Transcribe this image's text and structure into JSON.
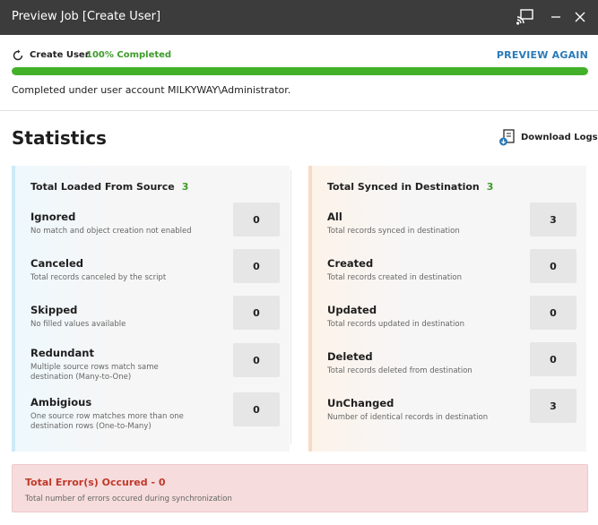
{
  "window": {
    "title": "Preview Job [Create User]"
  },
  "job": {
    "name": "Create User",
    "progress_text": "100% Completed",
    "progress_value": 1.0,
    "preview_again_label": "PREVIEW AGAIN",
    "account_message": "Completed under user account MILKYWAY\\Administrator."
  },
  "statistics": {
    "title": "Statistics",
    "download_logs_label": "Download Logs"
  },
  "source_panel": {
    "title": "Total Loaded From Source",
    "count": "3",
    "rows": [
      {
        "label": "Ignored",
        "desc": "No match and object creation not enabled",
        "value": "0"
      },
      {
        "label": "Canceled",
        "desc": "Total records canceled by the script",
        "value": "0"
      },
      {
        "label": "Skipped",
        "desc": "No filled values available",
        "value": "0"
      },
      {
        "label": "Redundant",
        "desc": "Multiple source rows match same destination (Many-to-One)",
        "value": "0"
      },
      {
        "label": "Ambigious",
        "desc": "One source row matches more than one destination rows (One-to-Many)",
        "value": "0"
      }
    ]
  },
  "destination_panel": {
    "title": "Total Synced in Destination",
    "count": "3",
    "rows": [
      {
        "label": "All",
        "desc": "Total records synced in destination",
        "value": "3"
      },
      {
        "label": "Created",
        "desc": "Total records created in destination",
        "value": "0"
      },
      {
        "label": "Updated",
        "desc": "Total records updated in destination",
        "value": "0"
      },
      {
        "label": "Deleted",
        "desc": "Total records deleted from destination",
        "value": "0"
      },
      {
        "label": "UnChanged",
        "desc": "Number of identical records in destination",
        "value": "3"
      }
    ]
  },
  "errors": {
    "title": "Total Error(s) Occured - 0",
    "desc": "Total number of errors occured during synchronization"
  },
  "colors": {
    "titlebar": "#3c3c3c",
    "progress_fill": "#43b02a",
    "success_text": "#3e9b2a",
    "link": "#2a7ab8",
    "error_text": "#c0392b",
    "error_bg": "#f6dcdc"
  },
  "icons": [
    "refresh-icon",
    "cast-icon",
    "minimize-icon",
    "close-icon",
    "download-logs-icon"
  ]
}
